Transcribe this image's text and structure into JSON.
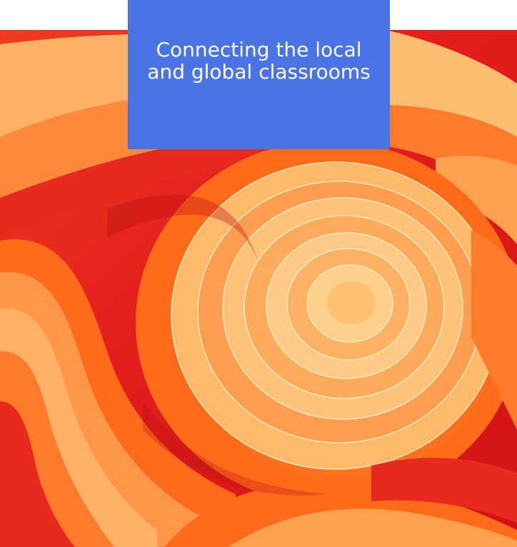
{
  "title": {
    "line1": "Connecting the local",
    "line2": "and global classrooms"
  },
  "colors": {
    "title_box": "#4a73e3",
    "title_text": "#ffffff",
    "hero_red": "#e21d1d",
    "hero_orange": "#ff6b1a",
    "hero_peach": "#ffb067",
    "hero_cream": "#ffd18c"
  }
}
